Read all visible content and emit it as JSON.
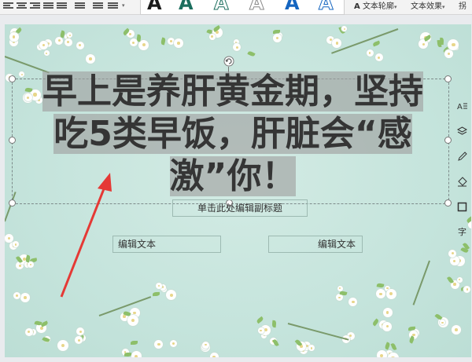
{
  "toolbar": {
    "text_outline": "文本轮廓",
    "text_effects": "文本效果",
    "wordart_glyph": "A",
    "edge_label": "拐"
  },
  "slide": {
    "title": "早上是养肝黄金期，坚持吃5类早饭，肝脏会“感激”你！",
    "title_lines": [
      "早上是养肝黄金期，坚持",
      "吃5类早饭，肝脏会“感",
      "激”你！"
    ],
    "subtitle_placeholder": "单击此处编辑副标题",
    "text_left": "编辑文本",
    "text_right": "编辑文本"
  },
  "side_tools": {
    "char_label": "字"
  },
  "colors": {
    "slide_bg": "#c5e4dc",
    "title_text": "#353535",
    "highlight": "#9e9e9e",
    "arrow": "#e53935"
  }
}
